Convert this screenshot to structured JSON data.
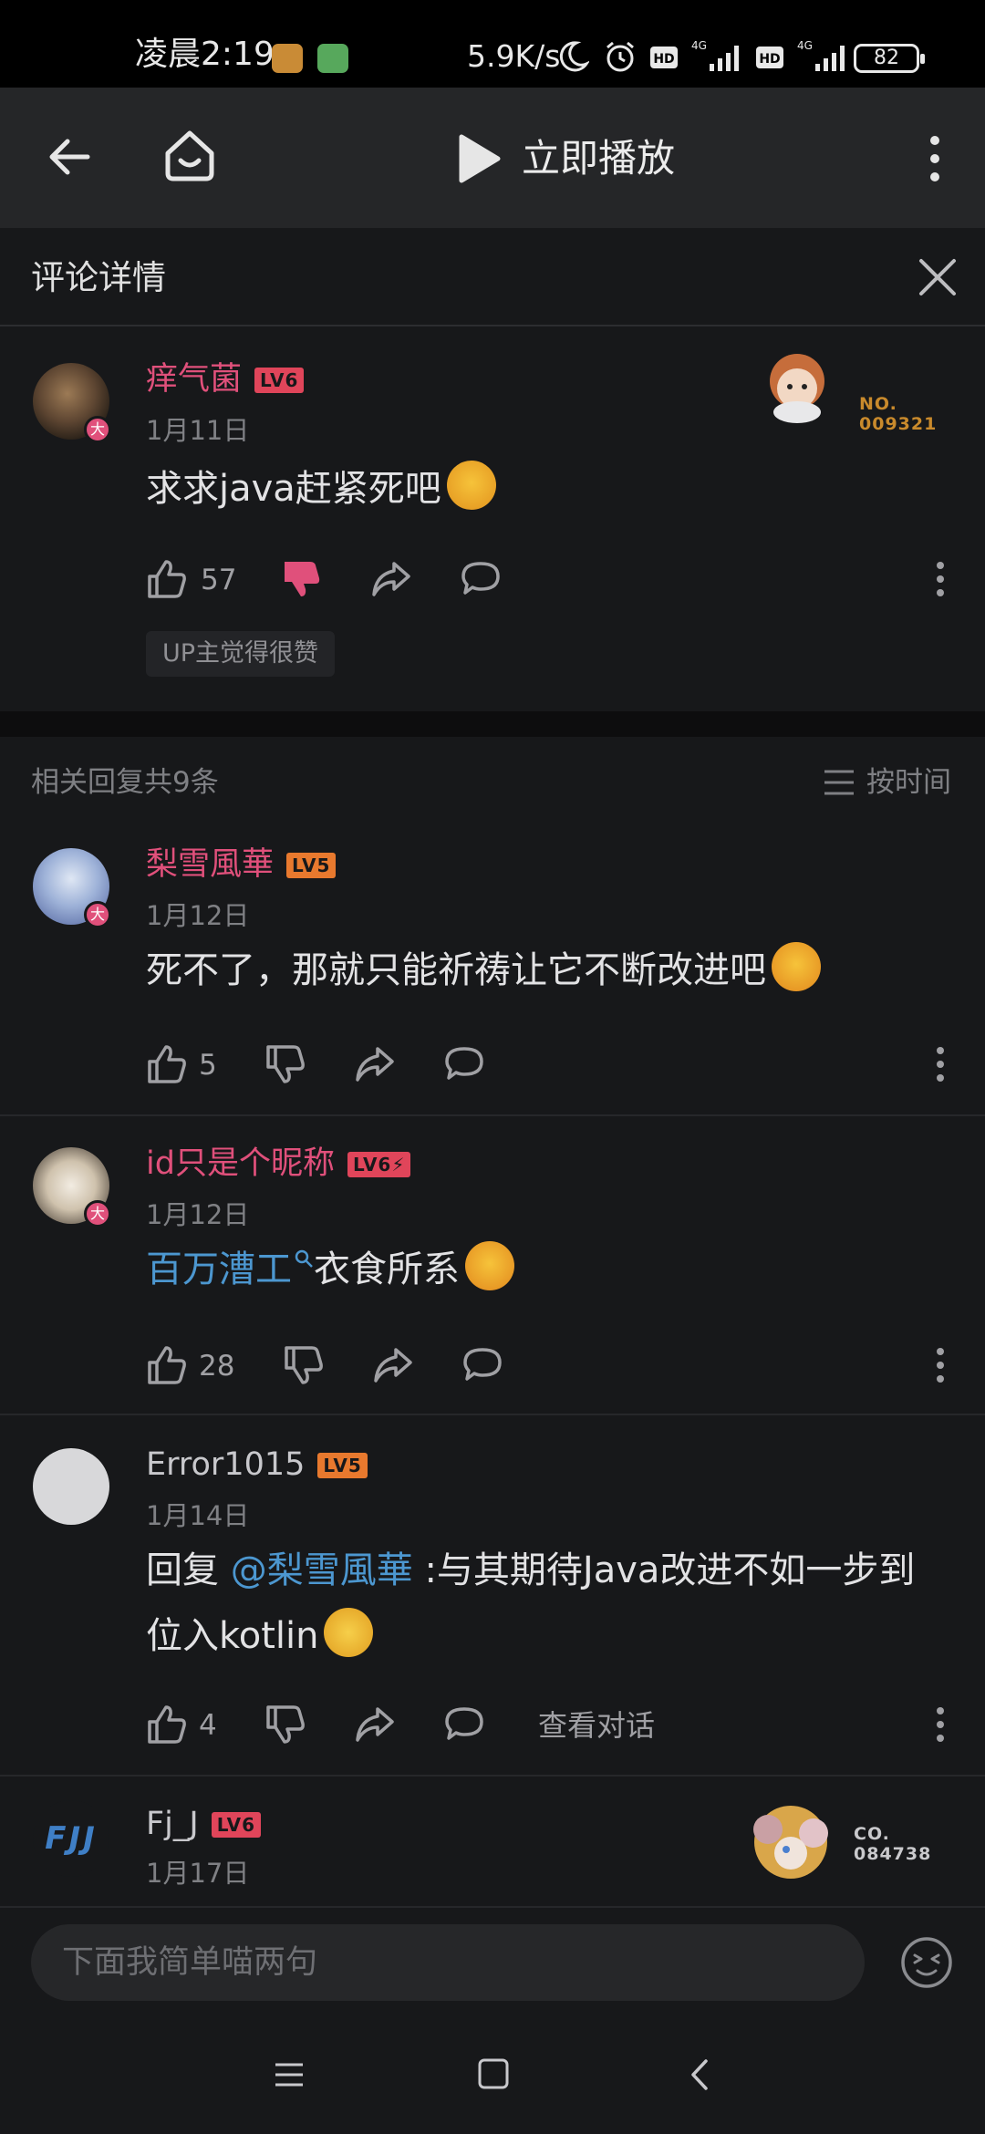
{
  "status_bar": {
    "time": "凌晨2:19",
    "net_speed": "5.9K/s",
    "hd": "HD",
    "network": "4G",
    "battery": "82"
  },
  "nav": {
    "play_label": "立即播放"
  },
  "sheet": {
    "title": "评论详情"
  },
  "main_comment": {
    "username": "痒气菌",
    "level": "LV6",
    "date": "1月11日",
    "text": "求求java赶紧死吧",
    "likes": "57",
    "up_tag": "UP主觉得很赞",
    "fan_badge_label": "NO.",
    "fan_badge_number": "009321"
  },
  "replies_header": {
    "count_label": "相关回复共9条",
    "sort_label": "按时间"
  },
  "replies": [
    {
      "username": "梨雪風華",
      "level": "LV5",
      "date": "1月12日",
      "text": "死不了，那就只能祈祷让它不断改进吧",
      "likes": "5"
    },
    {
      "username": "id只是个昵称",
      "level": "LV6⚡",
      "date": "1月12日",
      "link_text": "百万漕工",
      "text": "衣食所系",
      "likes": "28"
    },
    {
      "username": "Error1015",
      "level": "LV5",
      "date": "1月14日",
      "reply_prefix": "回复",
      "mention": "@梨雪風華",
      "text": ":与其期待Java改进不如一步到位入kotlin",
      "likes": "4",
      "view_conversation": "查看对话"
    },
    {
      "avatar_text": "FJJ",
      "username": "Fj_J",
      "level": "LV6",
      "date": "1月17日",
      "fan_badge_label": "CO.",
      "fan_badge_number": "084738"
    }
  ],
  "input": {
    "placeholder": "下面我简单喵两句"
  },
  "colors": {
    "accent_pink": "#e0507b",
    "link_blue": "#4c97d0",
    "background": "#17181a",
    "lv5_orange": "#e8792e",
    "lv6_red": "#e0455a"
  },
  "avatar_badge": "大"
}
